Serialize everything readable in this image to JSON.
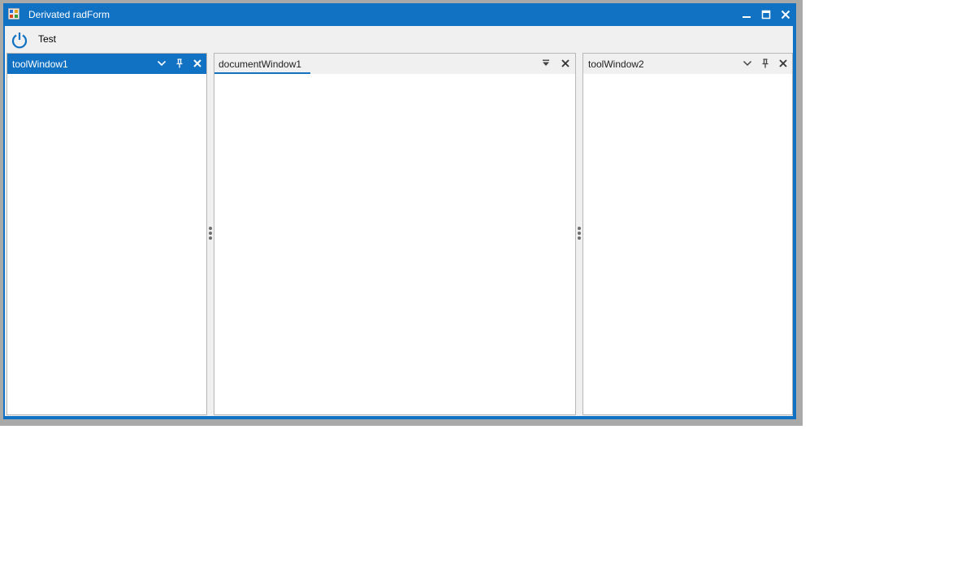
{
  "window": {
    "title": "Derivated radForm",
    "accent_color": "#1172c3",
    "controls": [
      "minimize-icon",
      "maximize-icon",
      "close-icon"
    ]
  },
  "toolbar": {
    "power_icon": "power-icon",
    "menu_label": "Test"
  },
  "panes": {
    "tool_window_1": {
      "title": "toolWindow1",
      "active": true,
      "buttons": [
        "chevron-down-icon",
        "pin-icon",
        "close-icon"
      ]
    },
    "document_window_1": {
      "tab_label": "documentWindow1",
      "buttons": [
        "dropdown-arrow-icon",
        "close-icon"
      ]
    },
    "tool_window_2": {
      "title": "toolWindow2",
      "active": false,
      "buttons": [
        "chevron-down-icon",
        "pin-icon",
        "close-icon"
      ]
    }
  }
}
